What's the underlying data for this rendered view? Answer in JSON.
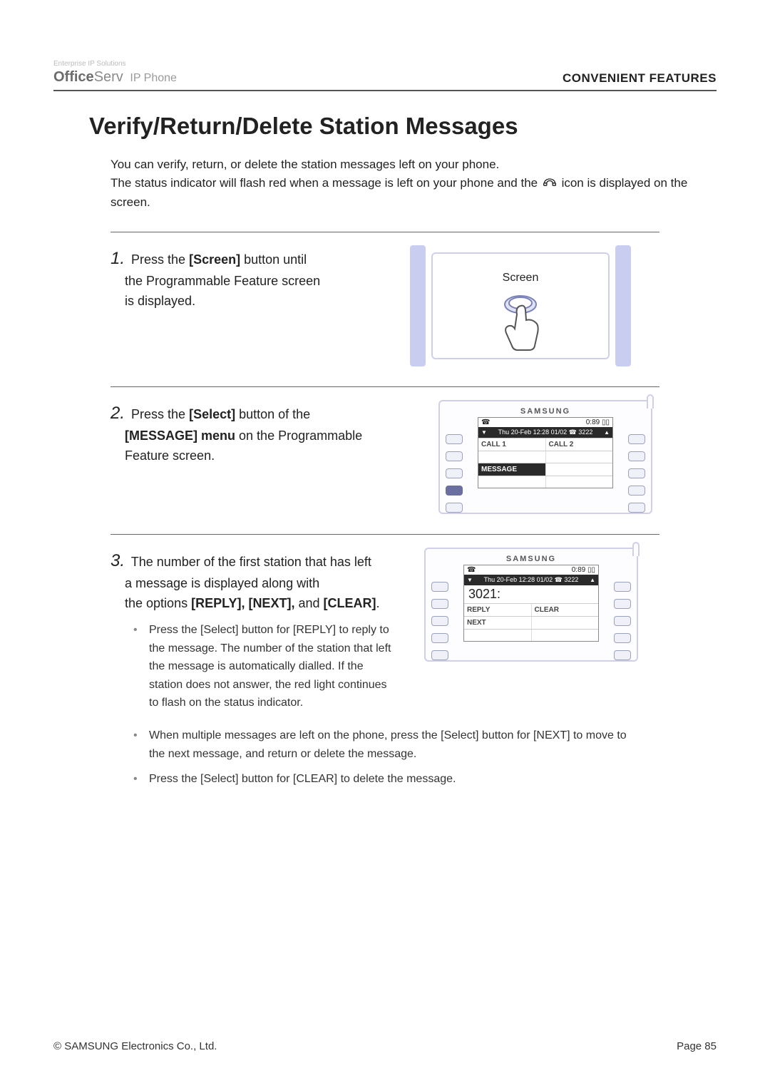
{
  "header": {
    "logo_tag": "Enterprise IP Solutions",
    "logo_bold": "Office",
    "logo_rest": "Serv",
    "logo_ip": "IP Phone",
    "section_label": "CONVENIENT FEATURES"
  },
  "title": "Verify/Return/Delete Station Messages",
  "intro": {
    "line1": "You can verify, return, or delete the station messages left on your phone.",
    "line2a": "The status indicator will flash red when a message is left on your phone and the ",
    "line2b": " icon is displayed on the",
    "line3": "screen."
  },
  "steps": {
    "s1": {
      "num": "1.",
      "text_a": "Press the ",
      "bold_a": "[Screen]",
      "text_b": " button until",
      "text_c": "the Programmable Feature screen",
      "text_d": "is displayed."
    },
    "s2": {
      "num": "2.",
      "text_a": "Press the ",
      "bold_a": "[Select]",
      "text_b": " button of the",
      "bold_b": "[MESSAGE] menu",
      "text_c": " on the Programmable",
      "text_d": "Feature screen."
    },
    "s3": {
      "num": "3.",
      "text_a": "The number of the first station that has left",
      "text_b": "a message is displayed along with",
      "text_c": "the options ",
      "bold_a": "[REPLY], [NEXT],",
      "text_d": " and ",
      "bold_b": "[CLEAR]",
      "text_e": "."
    }
  },
  "bullets": {
    "b1": "Press the [Select] button for [REPLY] to reply to the message. The number of the station that left the message is automatically dialled. If the station does not answer, the red light continues to flash on the status indicator.",
    "b2": "When multiple messages are left on the phone, press the [Select] button for [NEXT] to move to the next message, and return or delete the message.",
    "b3": "Press the [Select] button for [CLEAR] to delete the message."
  },
  "illus1": {
    "button_label": "Screen"
  },
  "device_a": {
    "brand": "SAMSUNG",
    "datebar": "Thu 20-Feb 12:28  01/02 ☎ 3222",
    "cell_call1": "CALL 1",
    "cell_call2": "CALL 2",
    "cell_message": "MESSAGE",
    "top_right_stat": "0:89 ▯▯"
  },
  "device_b": {
    "brand": "SAMSUNG",
    "datebar": "Thu 20-Feb 12:28  01/02 ☎ 3222",
    "big": "3021:",
    "reply": "REPLY",
    "clear": "CLEAR",
    "next": "NEXT",
    "top_right_stat": "0:89 ▯▯"
  },
  "footer": {
    "copyright": "© SAMSUNG Electronics Co., Ltd.",
    "page": "Page 85"
  }
}
